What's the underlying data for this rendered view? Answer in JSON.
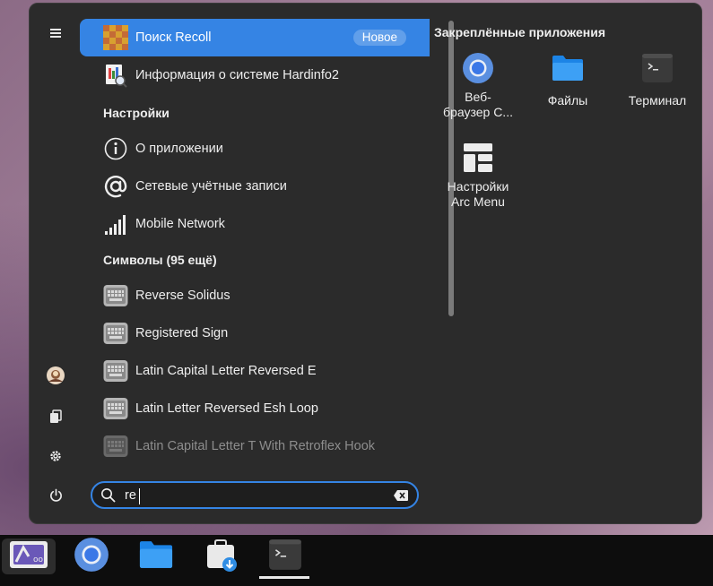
{
  "results": {
    "apps": [
      {
        "label": "Поиск Recoll",
        "badge": "Новое",
        "icon": "recoll-icon",
        "selected": true
      },
      {
        "label": "Информация о системе Hardinfo2",
        "icon": "hardinfo-icon"
      }
    ],
    "settings_header": "Настройки",
    "settings": [
      {
        "label": "О приложении",
        "icon": "info-icon"
      },
      {
        "label": "Сетевые учётные записи",
        "icon": "at-icon"
      },
      {
        "label": "Mobile Network",
        "icon": "signal-icon"
      }
    ],
    "symbols_header": "Символы  (95 ещё)",
    "symbols": [
      {
        "label": "Reverse Solidus",
        "icon": "keyboard-icon"
      },
      {
        "label": "Registered Sign",
        "icon": "keyboard-icon"
      },
      {
        "label": "Latin Capital Letter Reversed E",
        "icon": "keyboard-icon"
      },
      {
        "label": "Latin Letter Reversed Esh Loop",
        "icon": "keyboard-icon"
      },
      {
        "label": "Latin Capital Letter T With Retroflex Hook",
        "icon": "keyboard-icon"
      }
    ]
  },
  "pinned": {
    "title": "Закреплённые приложения",
    "apps": [
      {
        "label": "Веб-\nбраузер С...",
        "line1": "Веб-",
        "line2": "браузер С...",
        "icon": "chromium-icon"
      },
      {
        "label": "Файлы",
        "icon": "folder-icon"
      },
      {
        "label": "Терминал",
        "icon": "terminal-icon"
      },
      {
        "label": "Настройки Arc Menu",
        "line1": "Настройки",
        "line2": "Arc Menu",
        "icon": "arcmenu-settings-icon"
      }
    ]
  },
  "search": {
    "value": "re",
    "placeholder": ""
  },
  "sidebar": [
    "hamburger-icon",
    "avatar",
    "documents-icon",
    "gear-icon",
    "power-icon"
  ],
  "taskbar": [
    "arcmenu-launcher-icon",
    "chromium-icon",
    "folder-icon",
    "software-store-icon",
    "terminal-icon"
  ],
  "colors": {
    "accent": "#3584e4",
    "menu_bg": "#2b2b2b",
    "taskbar_bg": "#0d0d0d"
  }
}
